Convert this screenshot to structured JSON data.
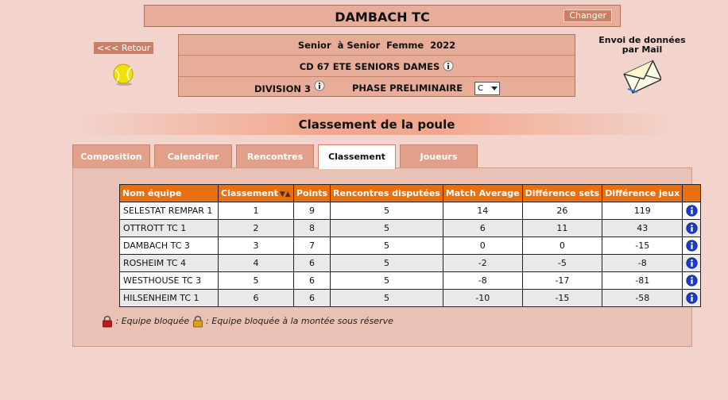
{
  "header": {
    "club_name": "DAMBACH TC",
    "changer_label": "Changer",
    "retour_label": "<<< Retour"
  },
  "competition": {
    "title": "Senior  à Senior  Femme  2022",
    "name": "CD 67 ETE SENIORS DAMES",
    "division": "DIVISION 3",
    "phase": "PHASE PRELIMINAIRE",
    "poule_selected": "C"
  },
  "mail": {
    "label": "Envoi de données par Mail"
  },
  "section_title": "Classement de la poule",
  "tabs": [
    {
      "label": "Composition"
    },
    {
      "label": "Calendrier"
    },
    {
      "label": "Rencontres"
    },
    {
      "label": "Classement"
    },
    {
      "label": "Joueurs"
    }
  ],
  "table": {
    "headers": [
      "Nom équipe",
      "Classement",
      "Points",
      "Rencontres disputées",
      "Match Average",
      "Différence sets",
      "Différence jeux"
    ],
    "sort_arrows": "▼▲",
    "rows": [
      [
        "SELESTAT REMPAR 1",
        "1",
        "9",
        "5",
        "14",
        "26",
        "119"
      ],
      [
        "OTTROTT TC 1",
        "2",
        "8",
        "5",
        "6",
        "11",
        "43"
      ],
      [
        "DAMBACH TC 3",
        "3",
        "7",
        "5",
        "0",
        "0",
        "-15"
      ],
      [
        "ROSHEIM TC 4",
        "4",
        "6",
        "5",
        "-2",
        "-5",
        "-8"
      ],
      [
        "WESTHOUSE TC 3",
        "5",
        "6",
        "5",
        "-8",
        "-17",
        "-81"
      ],
      [
        "HILSENHEIM TC 1",
        "6",
        "6",
        "5",
        "-10",
        "-15",
        "-58"
      ]
    ]
  },
  "legend": {
    "blocked": ": Equipe bloquée",
    "blocked_promotion": ": Equipe bloquée à la montée sous réserve"
  },
  "colors": {
    "page_bg": "#f2d4cc",
    "header_bg": "#e8ad98",
    "table_header": "#e87010",
    "info_blue": "#1a3cc8"
  }
}
